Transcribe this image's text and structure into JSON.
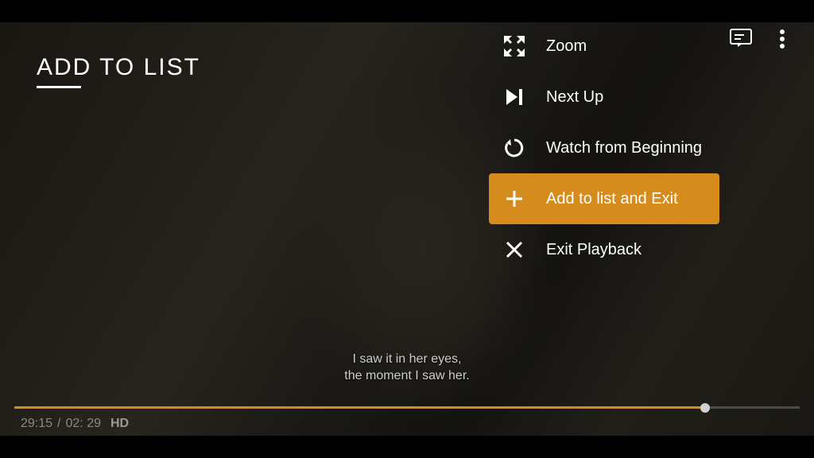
{
  "title": "ADD TO LIST",
  "menu": {
    "items": [
      {
        "label": "Zoom",
        "icon": "zoom",
        "selected": false
      },
      {
        "label": "Next Up",
        "icon": "next",
        "selected": false
      },
      {
        "label": "Watch from Beginning",
        "icon": "rewind",
        "selected": false
      },
      {
        "label": "Add to list and Exit",
        "icon": "plus",
        "selected": true
      },
      {
        "label": "Exit Playback",
        "icon": "close",
        "selected": false
      }
    ]
  },
  "subtitle": {
    "line1": "I saw it in her eyes,",
    "line2": "the moment I saw her."
  },
  "playback": {
    "elapsed": "29:15",
    "remaining": "02:  29",
    "quality": "HD",
    "progress_percent": 88
  },
  "colors": {
    "accent": "#d68b1e"
  }
}
